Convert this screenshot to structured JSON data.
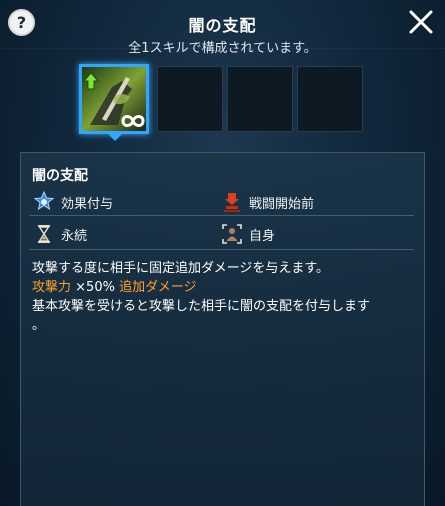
{
  "header": {
    "title": "闇の支配",
    "subtitle": "全1スキルで構成されています。",
    "help_label": "?",
    "close_label": "閉じる"
  },
  "skill_slots": [
    {
      "filled": true,
      "selected": true,
      "icon": "dark-knight-skill-icon"
    },
    {
      "filled": false
    },
    {
      "filled": false
    },
    {
      "filled": false
    }
  ],
  "detail": {
    "skill_name": "闇の支配",
    "attributes": [
      {
        "icon": "effect-grant-icon",
        "label": "効果付与"
      },
      {
        "icon": "pre-battle-icon",
        "label": "戦闘開始前"
      },
      {
        "icon": "hourglass-icon",
        "label": "永続"
      },
      {
        "icon": "self-target-icon",
        "label": "自身"
      }
    ],
    "description_line1": "攻撃する度に相手に固定追加ダメージを与えます。",
    "stat_label": "攻撃力",
    "stat_value": "×50%",
    "stat_suffix": "追加ダメージ",
    "description_line3": "基本攻撃を受けると攻撃した相手に闇の支配を付与します",
    "description_line4": "。"
  },
  "colors": {
    "accent_blue": "#2fa6ff",
    "highlight_orange": "#ffa126",
    "panel_border": "#3b5a72"
  }
}
